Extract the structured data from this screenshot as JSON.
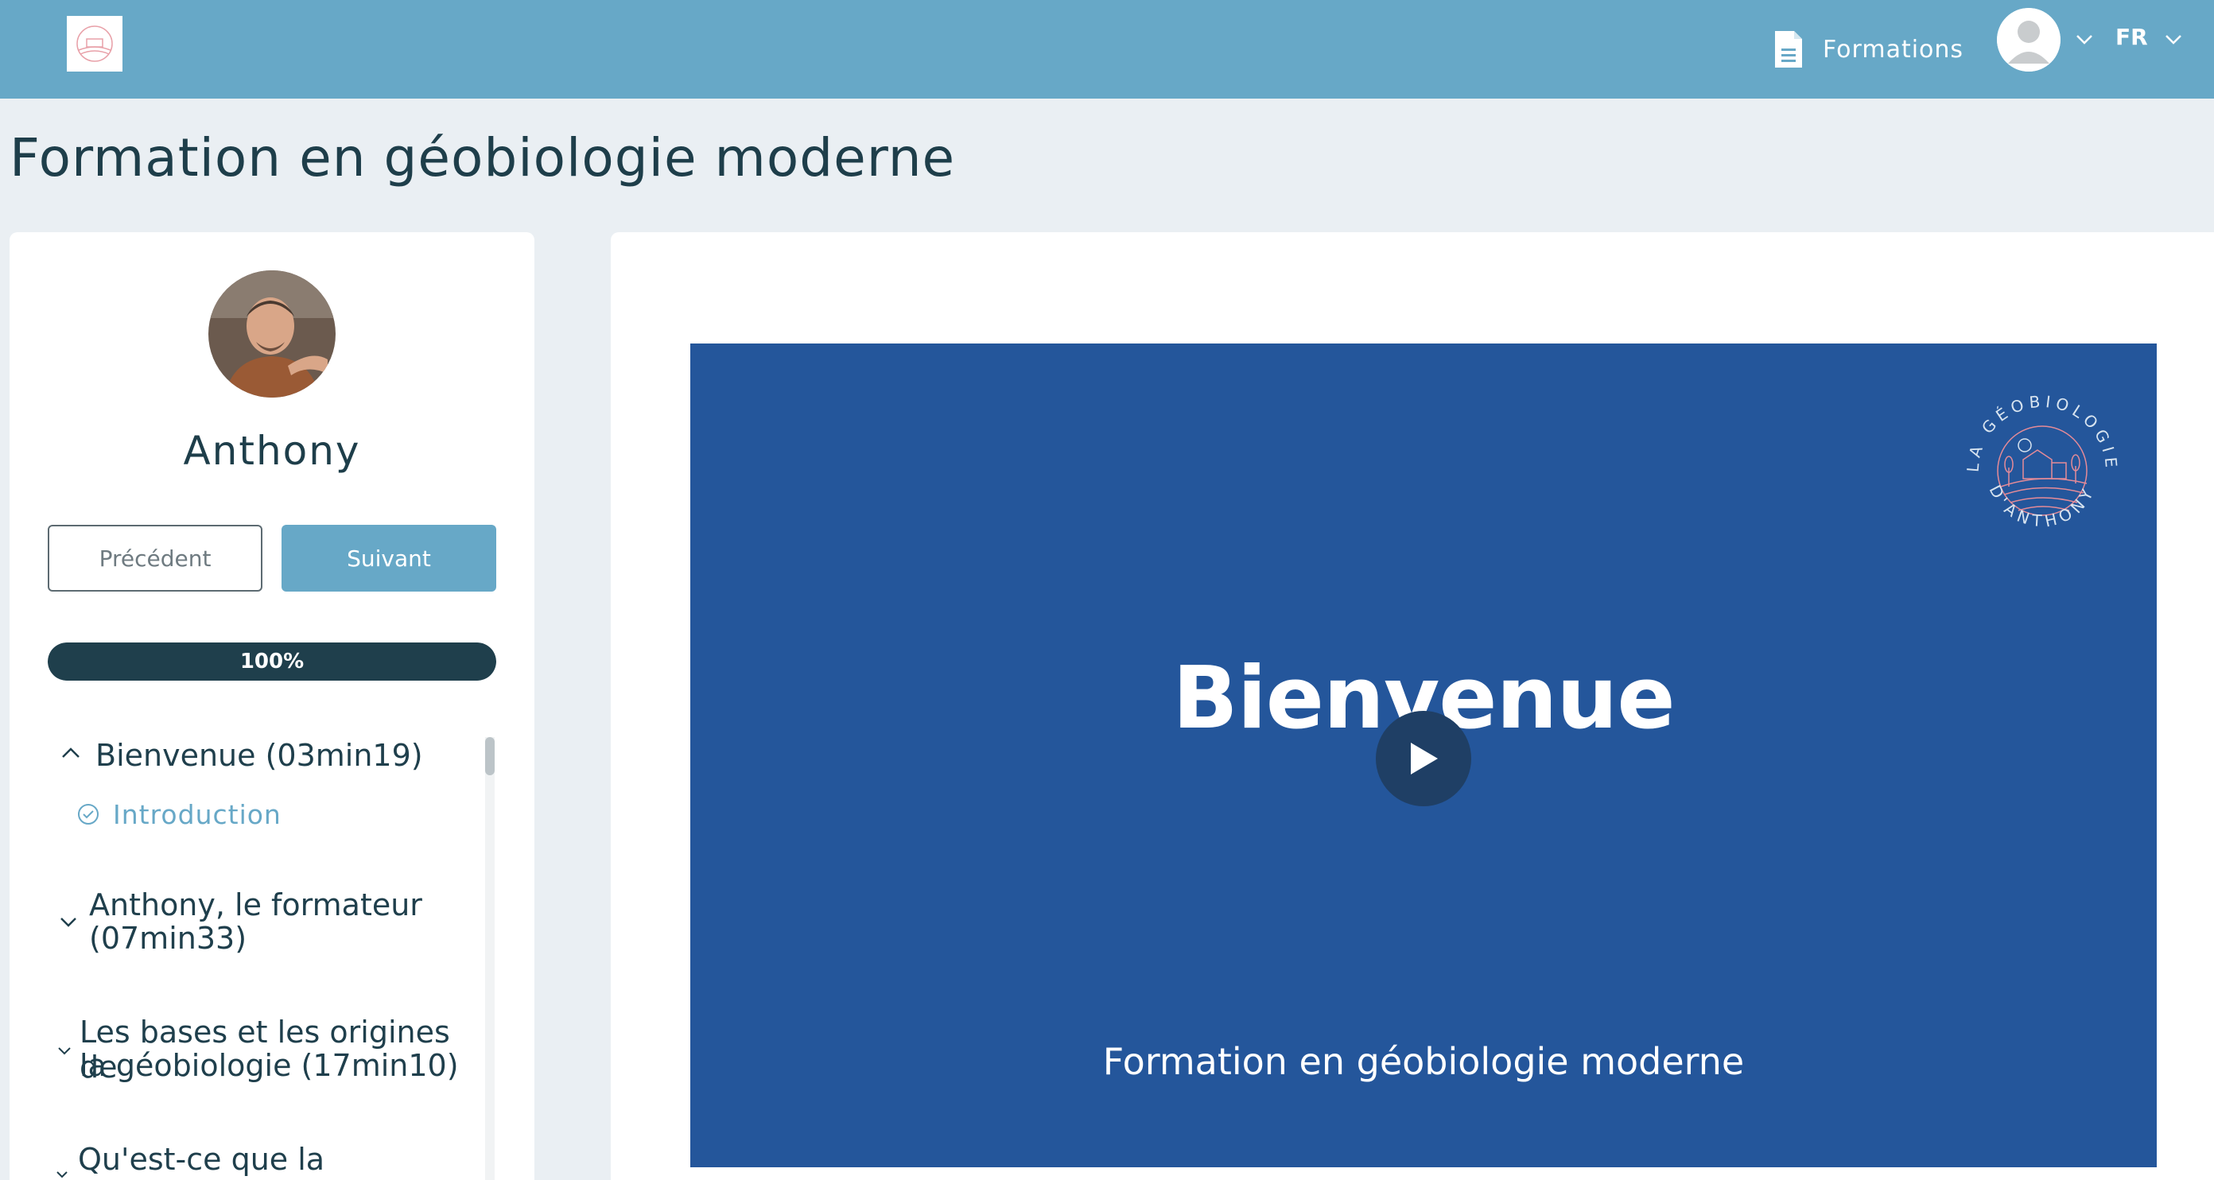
{
  "header": {
    "logo_icon": "geobiologie-logo-icon",
    "formations_label": "Formations",
    "formations_icon": "document-icon",
    "user_icon": "user-avatar-icon",
    "language": "FR",
    "colors": {
      "bar": "#67a8c7",
      "text": "#ffffff"
    }
  },
  "page": {
    "title": "Formation en géobiologie moderne"
  },
  "sidebar": {
    "trainer_name": "Anthony",
    "prev_label": "Précédent",
    "next_label": "Suivant",
    "progress": {
      "percent": 100,
      "label": "100%"
    },
    "sections": [
      {
        "title_lines": [
          "Bienvenue (03min19)"
        ],
        "expanded": true
      },
      {
        "title_lines": [
          "Anthony, le formateur",
          "(07min33)"
        ],
        "expanded": false
      },
      {
        "title_lines": [
          "Les bases et les origines de",
          "la géobiologie (17min10)"
        ],
        "expanded": false
      },
      {
        "title_lines": [
          "Qu'est-ce que la géobiologie"
        ],
        "expanded": false
      }
    ],
    "lesson": {
      "label": "Introduction",
      "completed": true
    }
  },
  "video": {
    "title": "Bienvenue",
    "subtitle": "Formation en géobiologie moderne",
    "logo_top_text": "LA GÉOBIOLOGIE",
    "logo_bottom_text": "D'ANTHONY",
    "background": "#24569b"
  }
}
